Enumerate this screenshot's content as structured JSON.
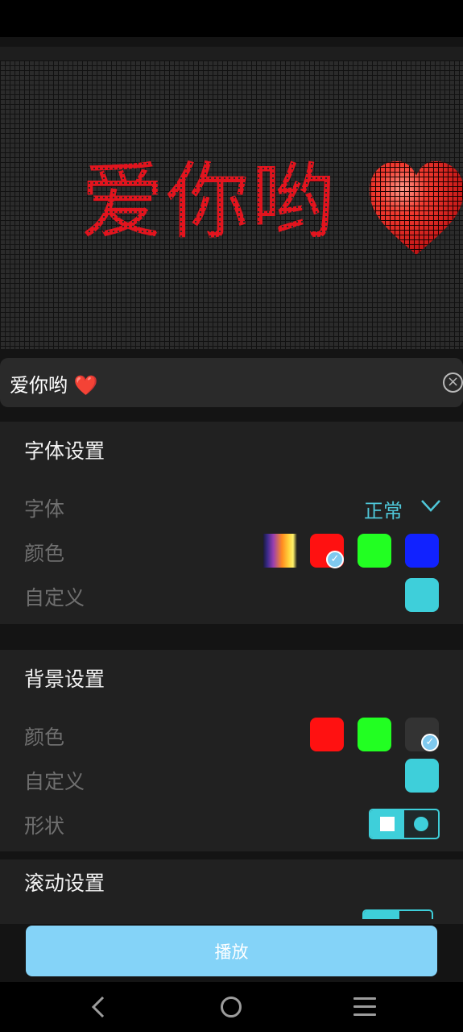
{
  "preview": {
    "text": "爱你哟",
    "heart_icon": "heart-icon",
    "text_color": "#e2141e"
  },
  "input": {
    "value": "爱你哟 ❤️",
    "clear_icon": "clear-icon"
  },
  "font_settings": {
    "title": "字体设置",
    "font_label": "字体",
    "font_value": "正常",
    "color_label": "颜色",
    "custom_label": "自定义",
    "swatches": [
      "gradient",
      "#ff1111",
      "#22ff22",
      "#1122ff"
    ],
    "selected_swatch": "#ff1111",
    "custom_color": "#3ecfda"
  },
  "background_settings": {
    "title": "背景设置",
    "color_label": "颜色",
    "custom_label": "自定义",
    "shape_label": "形状",
    "swatches": [
      "#ff1111",
      "#22ff22",
      "#333333"
    ],
    "selected_swatch": "#333333",
    "custom_color": "#3ecfda",
    "shape_selected": "square"
  },
  "scroll_settings": {
    "title": "滚动设置"
  },
  "play_button": {
    "label": "播放"
  },
  "colors": {
    "accent": "#3ecfda",
    "button": "#84d3f8"
  }
}
